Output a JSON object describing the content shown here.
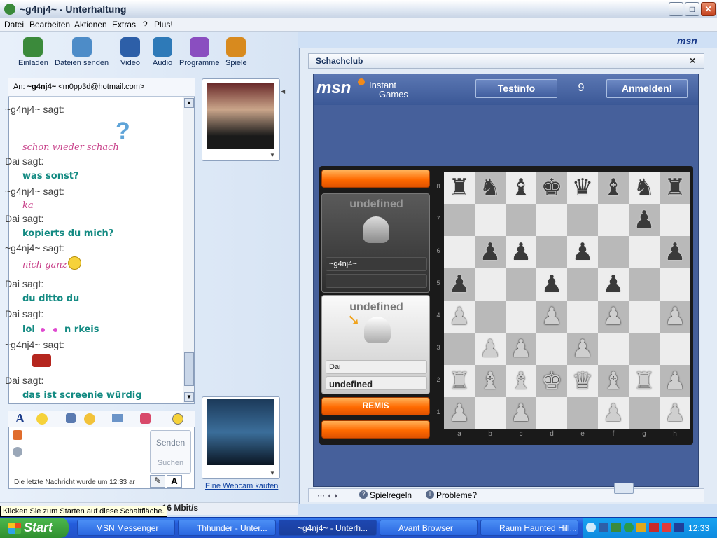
{
  "window": {
    "title": "~g4nj4~ - Unterhaltung",
    "min": "_",
    "max": "□",
    "close": "✕"
  },
  "menu": [
    "Datei",
    "Bearbeiten",
    "Aktionen",
    "Extras",
    "?",
    "Plus!"
  ],
  "brand": "msn",
  "toolbar": [
    {
      "label": "Einladen",
      "icon": "invite-icon",
      "color": "#3b8a3b"
    },
    {
      "label": "Dateien senden",
      "icon": "send-files-icon",
      "color": "#4d8cc8"
    },
    {
      "label": "Video",
      "icon": "video-icon",
      "color": "#2d5fa8"
    },
    {
      "label": "Audio",
      "icon": "audio-icon",
      "color": "#2e7ab8"
    },
    {
      "label": "Programme",
      "icon": "programs-icon",
      "color": "#8a4ec0"
    },
    {
      "label": "Spiele",
      "icon": "games-icon",
      "color": "#d88a1e"
    }
  ],
  "conversation": {
    "to_label": "An:",
    "to_name": "~g4nj4~",
    "to_email": "<m0pp3d@hotmail.com>",
    "messages": [
      {
        "who": "~g4nj4~ sagt:",
        "text": "schon wieder schach",
        "style": "pink"
      },
      {
        "who": "Dai sagt:",
        "text": "was sonst?",
        "style": "teal"
      },
      {
        "who": "~g4nj4~ sagt:",
        "text": "ka",
        "style": "pink"
      },
      {
        "who": "Dai sagt:",
        "text": "kopierts du mich?",
        "style": "teal"
      },
      {
        "who": "~g4nj4~ sagt:",
        "text": "nich ganz",
        "style": "pink"
      },
      {
        "who": "Dai sagt:",
        "text": "du ditto du",
        "style": "teal"
      },
      {
        "who": "Dai sagt:",
        "text": "lol",
        "style": "teal"
      },
      {
        "who": "~g4nj4~ sagt:",
        "text": "",
        "style": "pink"
      },
      {
        "who": "Dai sagt:",
        "text": "das ist screenie würdig",
        "style": "teal"
      }
    ],
    "lol_suffix": "n rkeis",
    "send_label": "Senden",
    "search_label": "Suchen",
    "last_message": "Die letzte Nachricht wurde um 12:33 ar",
    "webcam_link": "Eine Webcam kaufen",
    "speed": "zu 16 Mbit/s",
    "tooltip": "Klicken Sie zum Starten auf diese Schaltfläche."
  },
  "game": {
    "header": "Schachclub",
    "close": "×",
    "logo": "msn",
    "instant": "Instant",
    "games": "Games",
    "test_btn": "Testinfo",
    "score": "9",
    "signin_btn": "Anmelden!",
    "player1_label": "undefined",
    "player1_name": "~g4nj4~",
    "player2_label": "undefined",
    "player2_name": "Dai",
    "player2_sub": "undefined",
    "draw_btn": "REMIS",
    "ranks": [
      "8",
      "7",
      "6",
      "5",
      "4",
      "3",
      "2",
      "1"
    ],
    "files": [
      "a",
      "b",
      "c",
      "d",
      "e",
      "f",
      "g",
      "h"
    ],
    "rules": "Spielregeln",
    "problems": "Probleme?"
  },
  "board": [
    [
      "dr",
      "dn",
      "db",
      "dk",
      "dq",
      "db",
      "dn",
      "dr"
    ],
    [
      "",
      "",
      "",
      "",
      "",
      "",
      "dp",
      ""
    ],
    [
      "",
      "dp",
      "dp",
      "",
      "dp",
      "",
      "",
      "dp"
    ],
    [
      "dp",
      "",
      "",
      "dp",
      "",
      "dp",
      "",
      ""
    ],
    [
      "lp",
      "",
      "",
      "lp",
      "",
      "lp",
      "",
      "lp"
    ],
    [
      "",
      "lp",
      "lp",
      "",
      "lp",
      "",
      "",
      ""
    ],
    [
      "lr",
      "lb",
      "lb",
      "lk",
      "lq",
      "lb",
      "lr",
      "lp"
    ],
    [
      "lp",
      "",
      "lp",
      "",
      "",
      "lp",
      "",
      "lp"
    ]
  ],
  "taskbar": {
    "start": "Start",
    "tasks": [
      "MSN Messenger",
      "Thhunder - Unter...",
      "~g4nj4~ - Unterh...",
      "Avant Browser",
      "Raum Haunted Hill..."
    ],
    "clock": "12:33"
  }
}
